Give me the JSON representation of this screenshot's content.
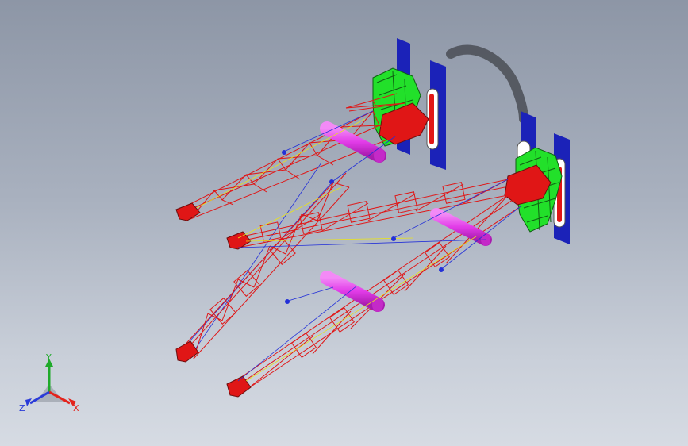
{
  "viewport": {
    "background_top": "#8d96a6",
    "background_bottom": "#d6dbe3"
  },
  "colors": {
    "boom_lattice": "#e01616",
    "boom_lattice_dark": "#6b0d0d",
    "hoist_rope": "#2330d8",
    "pendant_rope": "#e8e21c",
    "counterweight": "#22e02a",
    "track_frame": "#1b22b8",
    "cylinder": "#e23ce8",
    "shadow": "#4a4d55"
  },
  "model": {
    "assemblies": [
      {
        "name": "crane-left",
        "components": [
          "track-frame",
          "counterweight",
          "boom",
          "jib",
          "hook-block"
        ]
      },
      {
        "name": "crane-right",
        "components": [
          "track-frame",
          "counterweight",
          "boom",
          "jib",
          "hook-block"
        ]
      }
    ]
  },
  "triad": {
    "x_label": "X",
    "y_label": "Y",
    "z_label": "Z",
    "x_color": "#e3231c",
    "y_color": "#1faa2a",
    "z_color": "#2a3bd8"
  }
}
